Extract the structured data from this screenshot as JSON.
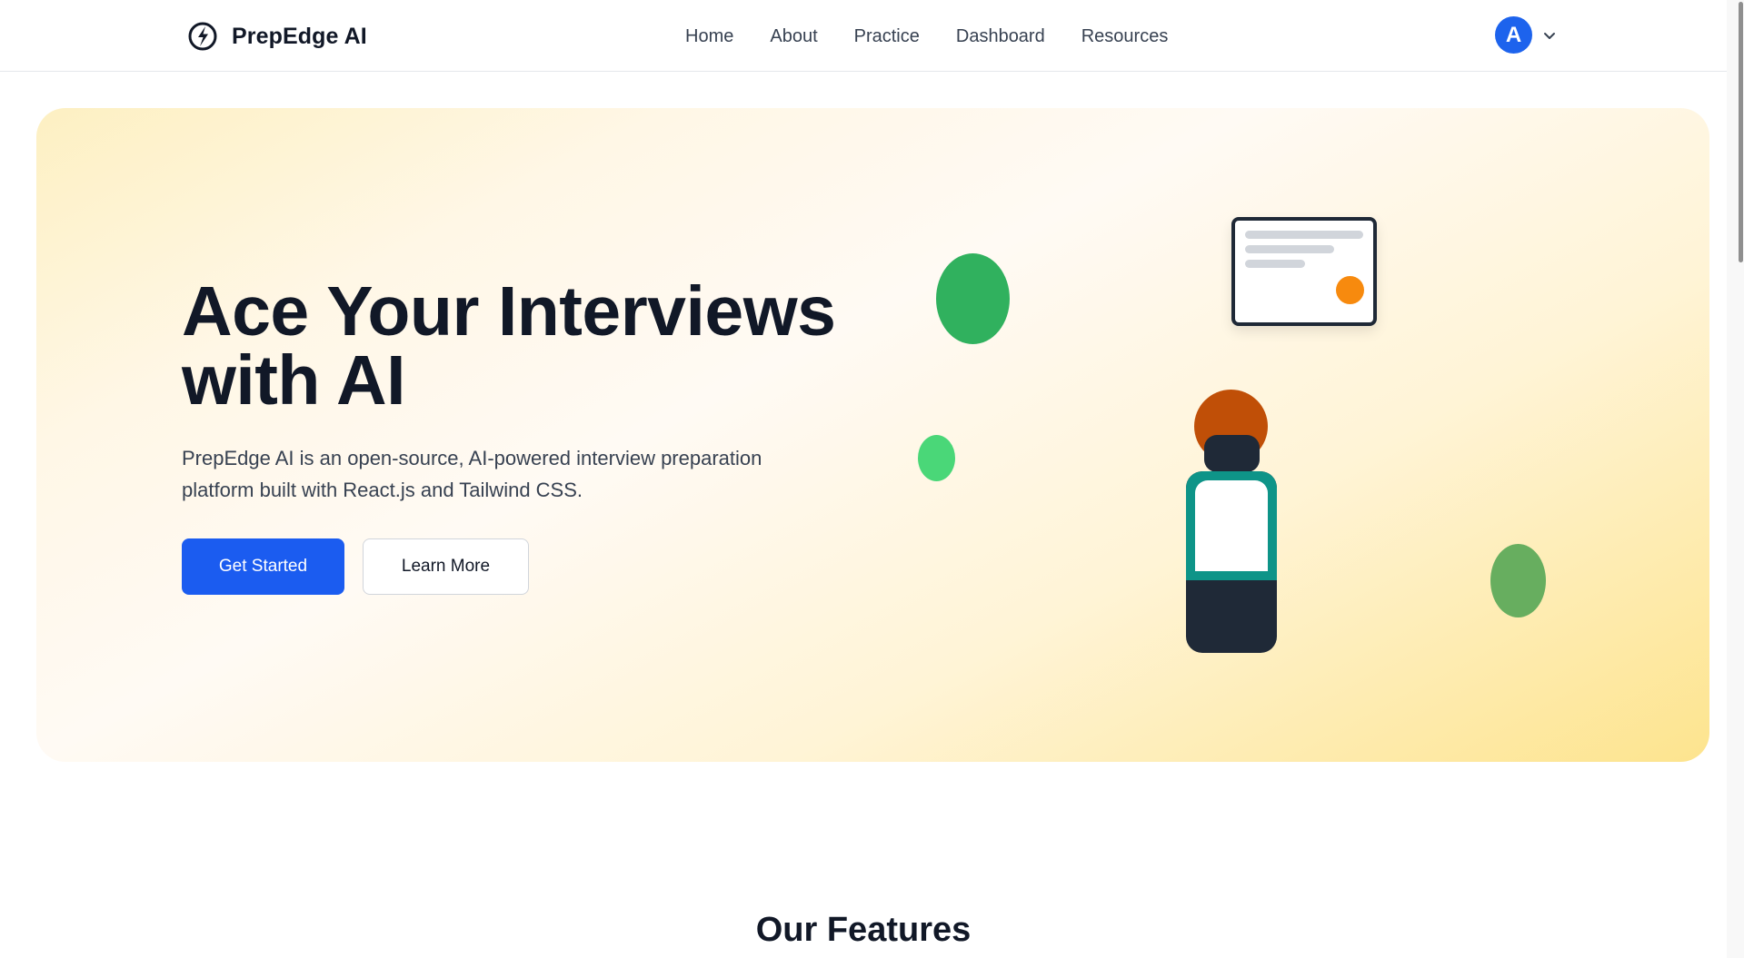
{
  "header": {
    "brand_name": "PrepEdge AI",
    "logo_icon": "brand-logo-icon",
    "nav": [
      {
        "label": "Home"
      },
      {
        "label": "About"
      },
      {
        "label": "Practice"
      },
      {
        "label": "Dashboard"
      },
      {
        "label": "Resources"
      }
    ],
    "user": {
      "avatar_initial": "A",
      "menu_icon": "chevron-down-icon"
    }
  },
  "hero": {
    "title_line1": "Ace Your Interviews",
    "title_line2": "with AI",
    "description_line1": "PrepEdge AI is an open-source, AI-powered interview preparation",
    "description_line2": "platform built with React.js and Tailwind CSS.",
    "primary_button": "Get Started",
    "secondary_button": "Learn More"
  },
  "features": {
    "title": "Our Features"
  },
  "colors": {
    "primary": "#1b5cf0",
    "avatar": "#1d63ed",
    "text_dark": "#111827",
    "hero_gradient_start": "#fdf0c2",
    "hero_gradient_end": "#fde48e"
  }
}
